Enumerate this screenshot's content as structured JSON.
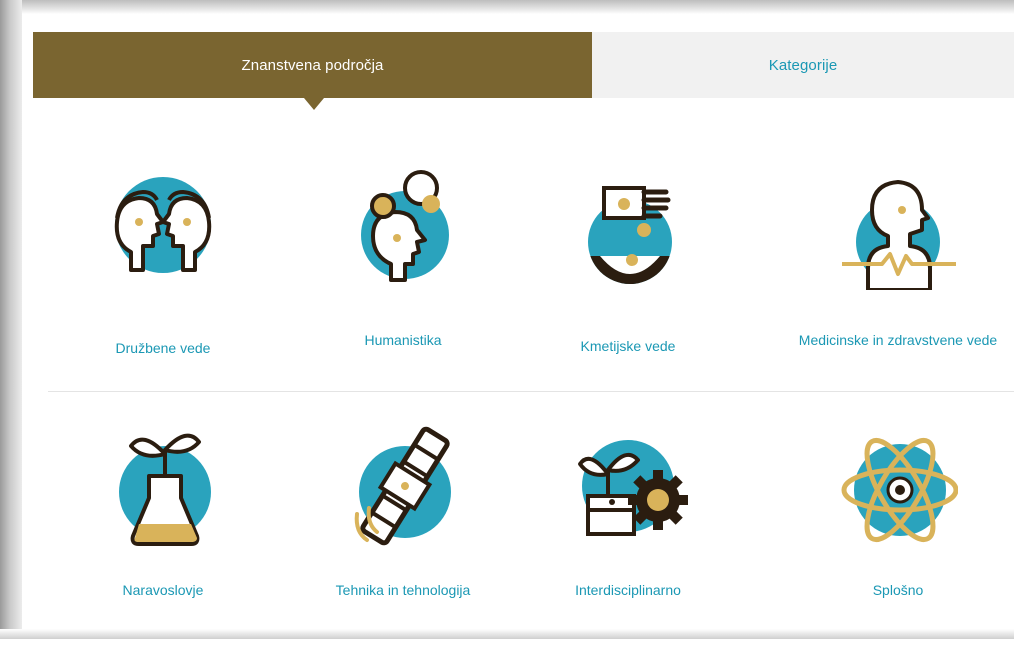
{
  "tabs": {
    "active": "Znanstvena področja",
    "inactive": "Kategorije"
  },
  "fields": [
    {
      "label": "Družbene vede",
      "icon": "two-faces-icon"
    },
    {
      "label": "Humanistika",
      "icon": "head-thoughts-icon"
    },
    {
      "label": "Kmetijske vede",
      "icon": "hand-seed-icon"
    },
    {
      "label": "Medicinske in zdravstvene vede",
      "icon": "heartbeat-person-icon"
    },
    {
      "label": "Naravoslovje",
      "icon": "flask-plant-icon"
    },
    {
      "label": "Tehnika in tehnologija",
      "icon": "satellite-icon"
    },
    {
      "label": "Interdisciplinarno",
      "icon": "plant-gear-icon"
    },
    {
      "label": "Splošno",
      "icon": "atom-icon"
    }
  ],
  "colors": {
    "brand": "#7a6530",
    "link": "#1b98b4",
    "icon_circle": "#2aa3bd",
    "icon_accent": "#d9b35a",
    "icon_stroke": "#2b1d10"
  }
}
